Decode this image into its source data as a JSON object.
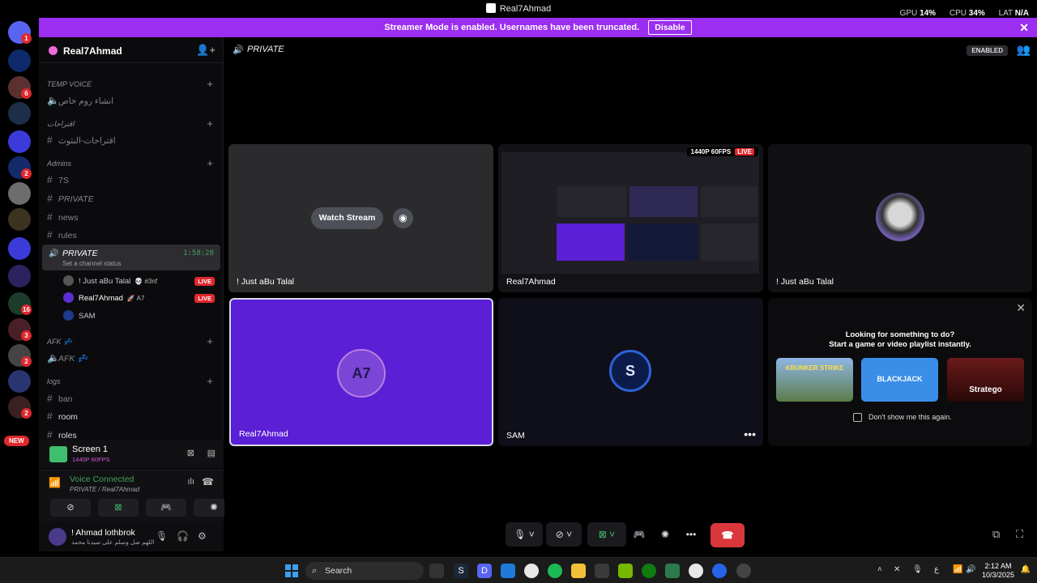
{
  "window": {
    "title": "Real7Ahmad",
    "gpu_label": "GPU",
    "gpu_value": "14%",
    "cpu_label": "CPU",
    "cpu_value": "34%",
    "lat_label": "LAT",
    "lat_value": "N/A"
  },
  "banner": {
    "text": "Streamer Mode is enabled. Usernames have been truncated.",
    "disable_label": "Disable",
    "close": "✕"
  },
  "rail": {
    "badges": [
      "1",
      "6",
      "2",
      "16",
      "3",
      "2",
      "2"
    ],
    "new_label": "NEW"
  },
  "sidebar": {
    "server_name": "Real7Ahmad",
    "categories": {
      "temp_voice": "TEMP VOICE",
      "suggestions": "اقتراحات",
      "admins": "Admins",
      "afk": "AFK 💤",
      "logs": "logs"
    },
    "channels": {
      "create_room": "انشاء روم خاص",
      "suggestions_chan": "اقتراحات-البثوث",
      "ts": "7S",
      "private_text": "PRIVATE",
      "news": "news",
      "rules": "rules",
      "private_voice": "PRIVATE",
      "private_status": "Set a channel status",
      "private_time": "1:58:28",
      "afk_voice": "AFK 💤",
      "ban": "ban",
      "room": "room",
      "roles": "roles"
    },
    "voice_users": [
      {
        "name": "! Just aBu Talal",
        "tag": "💀 #3nf",
        "live": "LIVE"
      },
      {
        "name": "Real7Ahmad",
        "tag": "🚀 A7",
        "live": "LIVE"
      },
      {
        "name": "SAM",
        "tag": "",
        "live": ""
      }
    ]
  },
  "screen_share": {
    "title": "Screen 1",
    "quality": "1440P 60FPS"
  },
  "voice": {
    "status": "Voice Connected",
    "location": "PRIVATE / Real7Ahmad"
  },
  "user": {
    "name": "! Ahmad lothbrok",
    "status": "اللهم صل وسلم على سيدنا محمد"
  },
  "main": {
    "channel": "PRIVATE",
    "enabled_label": "ENABLED",
    "tiles": {
      "t1_name": "! Just aBu Talal",
      "watch_label": "Watch Stream",
      "t2_name": "Real7Ahmad",
      "t2_quality": "1440P 60FPS",
      "t2_live": "LIVE",
      "t3_name": "! Just aBu Talal",
      "t4_name": "Real7Ahmad",
      "t4_avatar": "A7",
      "t5_name": "SAM",
      "t5_avatar": "S"
    },
    "activity": {
      "line1": "Looking for something to do?",
      "line2": "Start a game or video playlist instantly.",
      "games": [
        "KRUNKER STRIKE",
        "BLACKJACK",
        "Stratego"
      ],
      "dont_show": "Don't show me this again."
    }
  },
  "taskbar": {
    "search_placeholder": "Search",
    "time": "2:12 AM",
    "date": "10/3/2025",
    "lang": "ع"
  }
}
